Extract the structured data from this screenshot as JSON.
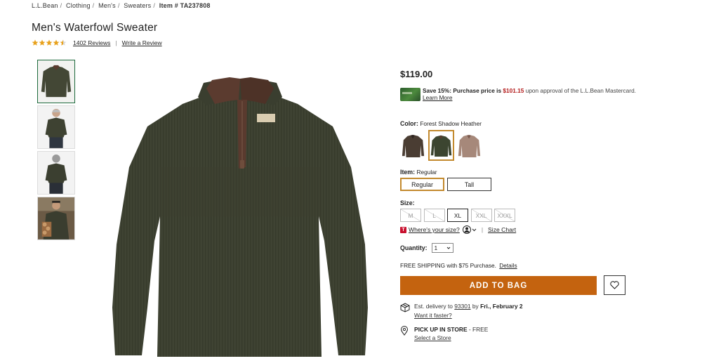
{
  "breadcrumb": {
    "items": [
      "L.L.Bean",
      "Clothing",
      "Men's",
      "Sweaters"
    ],
    "current": "Item # TA237808"
  },
  "product": {
    "title": "Men's Waterfowl Sweater",
    "rating_value": 4.5,
    "reviews_label": "1402 Reviews",
    "write_review_label": "Write a Review",
    "price": "$119.00"
  },
  "promo": {
    "save_text": "Save 15%: Purchase price is",
    "sale_price": "$101.15",
    "suffix": "upon approval of the L.L.Bean Mastercard.",
    "learn_more": "Learn More"
  },
  "color": {
    "label": "Color:",
    "selected_value": "Forest Shadow Heather",
    "swatch_colors": [
      "#4a3d33",
      "#3c4530",
      "#a6887a"
    ]
  },
  "item_type": {
    "label": "Item:",
    "selected_value": "Regular",
    "options": [
      "Regular",
      "Tall"
    ]
  },
  "size": {
    "label": "Size:",
    "options": [
      "M",
      "L",
      "XL",
      "XXL",
      "XXXL"
    ],
    "where_size": "Where's your size?",
    "size_chart": "Size Chart"
  },
  "quantity": {
    "label": "Quantity:",
    "value": "1"
  },
  "shipping": {
    "text": "FREE SHIPPING with $75 Purchase.",
    "details": "Details"
  },
  "cta": {
    "add_to_bag": "ADD TO BAG"
  },
  "delivery": {
    "prefix": "Est. delivery to",
    "zip": "93301",
    "by": "by",
    "date": "Fri., February 2",
    "faster": "Want it faster?"
  },
  "pickup": {
    "title": "PICK UP IN STORE",
    "free": "- FREE",
    "select_store": "Select a Store"
  },
  "colors": {
    "accent_orange": "#c4630f",
    "selected_outline": "#c38a2e",
    "sweater_green": "#3f4333"
  }
}
